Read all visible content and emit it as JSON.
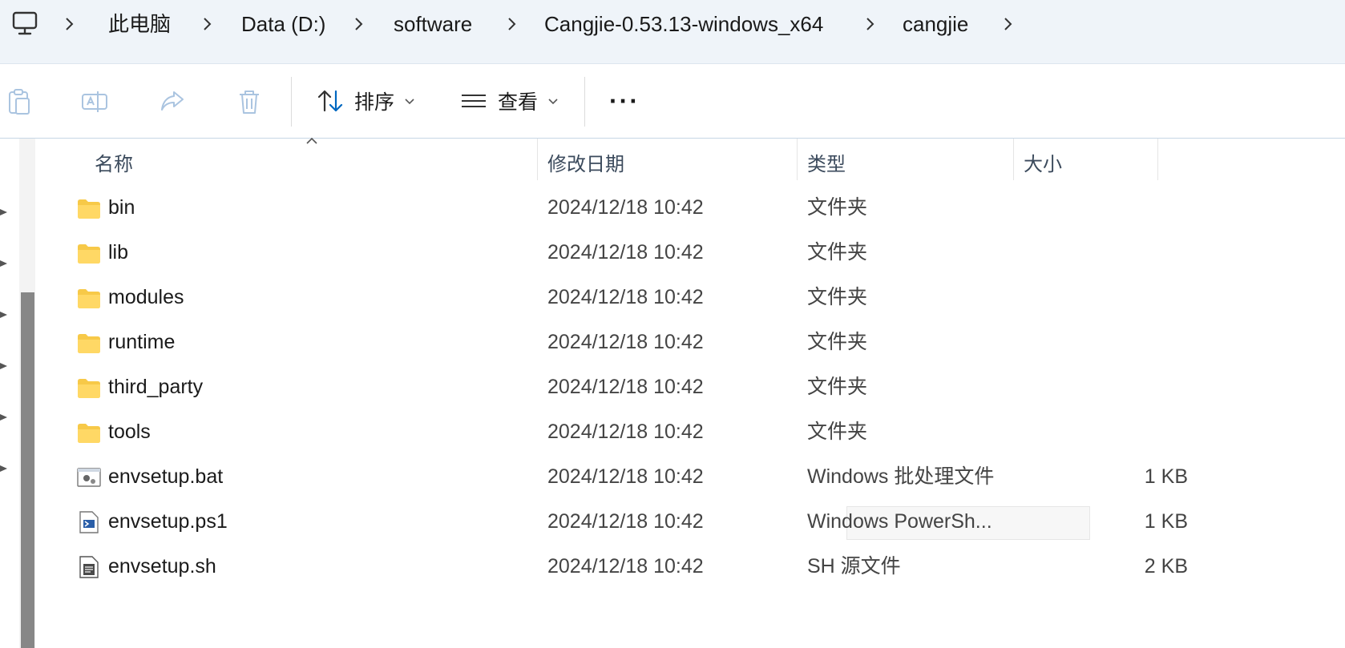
{
  "address": {
    "crumbs": [
      "此电脑",
      "Data (D:)",
      "software",
      "Cangjie-0.53.13-windows_x64",
      "cangjie"
    ]
  },
  "toolbar": {
    "sort_label": "排序",
    "view_label": "查看",
    "more_label": "···"
  },
  "columns": {
    "name": "名称",
    "date": "修改日期",
    "type": "类型",
    "size": "大小"
  },
  "files": [
    {
      "name": "bin",
      "date": "2024/12/18 10:42",
      "type": "文件夹",
      "size": "",
      "icon": "folder-icon"
    },
    {
      "name": "lib",
      "date": "2024/12/18 10:42",
      "type": "文件夹",
      "size": "",
      "icon": "folder-icon"
    },
    {
      "name": "modules",
      "date": "2024/12/18 10:42",
      "type": "文件夹",
      "size": "",
      "icon": "folder-icon"
    },
    {
      "name": "runtime",
      "date": "2024/12/18 10:42",
      "type": "文件夹",
      "size": "",
      "icon": "folder-icon"
    },
    {
      "name": "third_party",
      "date": "2024/12/18 10:42",
      "type": "文件夹",
      "size": "",
      "icon": "folder-icon"
    },
    {
      "name": "tools",
      "date": "2024/12/18 10:42",
      "type": "文件夹",
      "size": "",
      "icon": "folder-icon"
    },
    {
      "name": "envsetup.bat",
      "date": "2024/12/18 10:42",
      "type": "Windows 批处理文件",
      "size": "1 KB",
      "icon": "batch-file-icon"
    },
    {
      "name": "envsetup.ps1",
      "date": "2024/12/18 10:42",
      "type": "Windows PowerSh...",
      "size": "1 KB",
      "icon": "powershell-file-icon"
    },
    {
      "name": "envsetup.sh",
      "date": "2024/12/18 10:42",
      "type": "SH 源文件",
      "size": "2 KB",
      "icon": "text-file-icon"
    }
  ],
  "colors": {
    "folder": "#f7c948",
    "accent": "#0067c0",
    "address_bg": "#eff4f9"
  }
}
